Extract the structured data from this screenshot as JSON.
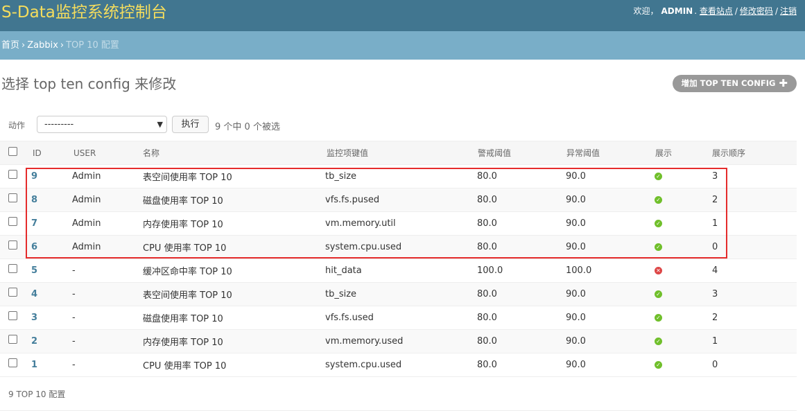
{
  "header": {
    "site_title": "S-Data监控系统控制台",
    "welcome": "欢迎，",
    "username": "ADMIN",
    "view_site": "查看站点",
    "change_password": "修改密码",
    "logout": "注销",
    "separator": "/"
  },
  "breadcrumbs": {
    "home": "首页",
    "app": "Zabbix",
    "current": "TOP 10 配置",
    "separator": "›"
  },
  "page": {
    "title": "选择 top ten config 来修改",
    "add_button": "增加 TOP TEN CONFIG",
    "add_icon": "plus-icon"
  },
  "actions": {
    "label": "动作",
    "selected_value": "---------",
    "go_button": "执行",
    "counter": "9 个中 0 个被选"
  },
  "table": {
    "headers": [
      "ID",
      "USER",
      "名称",
      "监控项键值",
      "警戒阈值",
      "异常阈值",
      "展示",
      "展示顺序"
    ],
    "rows": [
      {
        "id": "9",
        "user": "Admin",
        "name": "表空间使用率 TOP 10",
        "key": "tb_size",
        "warn": "80.0",
        "error": "90.0",
        "show": true,
        "order": "3"
      },
      {
        "id": "8",
        "user": "Admin",
        "name": "磁盘使用率 TOP 10",
        "key": "vfs.fs.pused",
        "warn": "80.0",
        "error": "90.0",
        "show": true,
        "order": "2"
      },
      {
        "id": "7",
        "user": "Admin",
        "name": "内存使用率 TOP 10",
        "key": "vm.memory.util",
        "warn": "80.0",
        "error": "90.0",
        "show": true,
        "order": "1"
      },
      {
        "id": "6",
        "user": "Admin",
        "name": "CPU 使用率 TOP 10",
        "key": "system.cpu.used",
        "warn": "80.0",
        "error": "90.0",
        "show": true,
        "order": "0"
      },
      {
        "id": "5",
        "user": "-",
        "name": "缓冲区命中率 TOP 10",
        "key": "hit_data",
        "warn": "100.0",
        "error": "100.0",
        "show": false,
        "order": "4"
      },
      {
        "id": "4",
        "user": "-",
        "name": "表空间使用率 TOP 10",
        "key": "tb_size",
        "warn": "80.0",
        "error": "90.0",
        "show": true,
        "order": "3"
      },
      {
        "id": "3",
        "user": "-",
        "name": "磁盘使用率 TOP 10",
        "key": "vfs.fs.used",
        "warn": "80.0",
        "error": "90.0",
        "show": true,
        "order": "2"
      },
      {
        "id": "2",
        "user": "-",
        "name": "内存使用率 TOP 10",
        "key": "vm.memory.used",
        "warn": "80.0",
        "error": "90.0",
        "show": true,
        "order": "1"
      },
      {
        "id": "1",
        "user": "-",
        "name": "CPU 使用率 TOP 10",
        "key": "system.cpu.used",
        "warn": "80.0",
        "error": "90.0",
        "show": true,
        "order": "0"
      }
    ]
  },
  "paginator": "9 TOP 10 配置",
  "colors": {
    "header_bg": "#417690",
    "title": "#f5dd5d",
    "breadcrumbs_bg": "#79aec8",
    "link": "#447e9b",
    "highlight": "#e52b2b",
    "ok": "#70bf2b",
    "no": "#dd4646"
  }
}
